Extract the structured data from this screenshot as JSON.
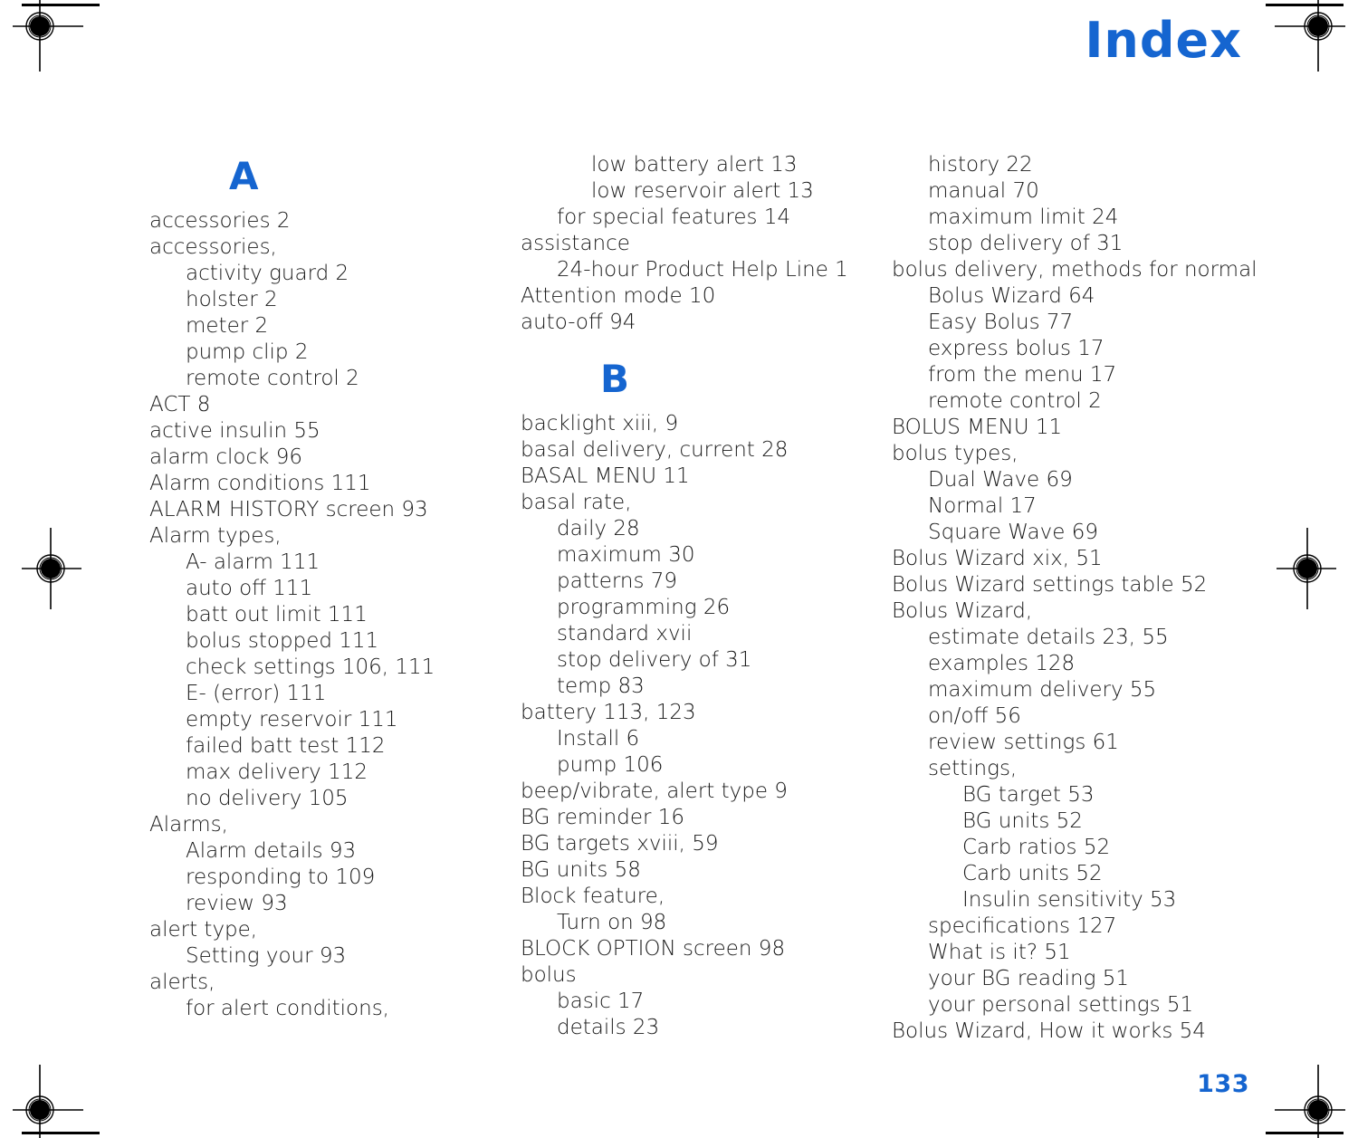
{
  "page": {
    "title": "Index",
    "folio": "133",
    "title_color": "#1565d0",
    "text_color": "#1a1a1a",
    "background_color": "#ffffff"
  },
  "marks": {
    "registration_icon": "registration-target-icon"
  },
  "columns": [
    {
      "id": "column-1",
      "blocks": [
        {
          "type": "letter",
          "label": "A",
          "spaced_above": false
        },
        {
          "type": "entries",
          "items": [
            {
              "level": 0,
              "text": "accessories 2"
            },
            {
              "level": 0,
              "text": "accessories,"
            },
            {
              "level": 1,
              "text": "activity guard 2"
            },
            {
              "level": 1,
              "text": "holster 2"
            },
            {
              "level": 1,
              "text": "meter 2"
            },
            {
              "level": 1,
              "text": "pump clip 2"
            },
            {
              "level": 1,
              "text": "remote control 2"
            },
            {
              "level": 0,
              "text": "ACT 8"
            },
            {
              "level": 0,
              "text": "active insulin 55"
            },
            {
              "level": 0,
              "text": "alarm clock 96"
            },
            {
              "level": 0,
              "text": "Alarm conditions 111"
            },
            {
              "level": 0,
              "text": "ALARM HISTORY screen 93"
            },
            {
              "level": 0,
              "text": "Alarm types,"
            },
            {
              "level": 1,
              "text": "A- alarm 111"
            },
            {
              "level": 1,
              "text": "auto off 111"
            },
            {
              "level": 1,
              "text": "batt out limit 111"
            },
            {
              "level": 1,
              "text": "bolus stopped 111"
            },
            {
              "level": 1,
              "text": "check settings 106, 111"
            },
            {
              "level": 1,
              "text": "E- (error) 111"
            },
            {
              "level": 1,
              "text": "empty reservoir 111"
            },
            {
              "level": 1,
              "text": "failed batt test 112"
            },
            {
              "level": 1,
              "text": "max delivery 112"
            },
            {
              "level": 1,
              "text": "no delivery 105"
            },
            {
              "level": 0,
              "text": "Alarms,"
            },
            {
              "level": 1,
              "text": "Alarm details 93"
            },
            {
              "level": 1,
              "text": "responding to 109"
            },
            {
              "level": 1,
              "text": "review 93"
            },
            {
              "level": 0,
              "text": "alert type,"
            },
            {
              "level": 1,
              "text": "Setting your 93"
            },
            {
              "level": 0,
              "text": "alerts,"
            },
            {
              "level": 1,
              "text": "for alert conditions,"
            }
          ]
        }
      ]
    },
    {
      "id": "column-2",
      "blocks": [
        {
          "type": "entries",
          "items": [
            {
              "level": 2,
              "text": "low battery alert 13"
            },
            {
              "level": 2,
              "text": "low reservoir alert 13"
            },
            {
              "level": 1,
              "text": "for special features 14"
            },
            {
              "level": 0,
              "text": "assistance"
            },
            {
              "level": 1,
              "text": "24-hour Product Help Line 1"
            },
            {
              "level": 0,
              "text": "Attention mode 10"
            },
            {
              "level": 0,
              "text": "auto-off 94"
            }
          ]
        },
        {
          "type": "letter",
          "label": "B",
          "spaced_above": true
        },
        {
          "type": "entries",
          "items": [
            {
              "level": 0,
              "text": "backlight xiii, 9"
            },
            {
              "level": 0,
              "text": "basal delivery, current 28"
            },
            {
              "level": 0,
              "text": "BASAL MENU 11"
            },
            {
              "level": 0,
              "text": "basal rate,"
            },
            {
              "level": 1,
              "text": "daily 28"
            },
            {
              "level": 1,
              "text": "maximum 30"
            },
            {
              "level": 1,
              "text": "patterns 79"
            },
            {
              "level": 1,
              "text": "programming 26"
            },
            {
              "level": 1,
              "text": "standard xvii"
            },
            {
              "level": 1,
              "text": "stop delivery of 31"
            },
            {
              "level": 1,
              "text": "temp 83"
            },
            {
              "level": 0,
              "text": "battery 113, 123"
            },
            {
              "level": 1,
              "text": "Install 6"
            },
            {
              "level": 1,
              "text": "pump 106"
            },
            {
              "level": 0,
              "text": "beep/vibrate, alert type 9"
            },
            {
              "level": 0,
              "text": "BG reminder 16"
            },
            {
              "level": 0,
              "text": "BG targets xviii, 59"
            },
            {
              "level": 0,
              "text": "BG units 58"
            },
            {
              "level": 0,
              "text": "Block feature,"
            },
            {
              "level": 1,
              "text": "Turn on 98"
            },
            {
              "level": 0,
              "text": "BLOCK OPTION screen 98"
            },
            {
              "level": 0,
              "text": "bolus"
            },
            {
              "level": 1,
              "text": "basic 17"
            },
            {
              "level": 1,
              "text": "details 23"
            }
          ]
        }
      ]
    },
    {
      "id": "column-3",
      "blocks": [
        {
          "type": "entries",
          "items": [
            {
              "level": 1,
              "text": "history 22"
            },
            {
              "level": 1,
              "text": "manual 70"
            },
            {
              "level": 1,
              "text": "maximum limit 24"
            },
            {
              "level": 1,
              "text": "stop delivery of 31"
            },
            {
              "level": 0,
              "text": "bolus delivery, methods for normal"
            },
            {
              "level": 1,
              "text": "Bolus Wizard 64"
            },
            {
              "level": 1,
              "text": "Easy Bolus 77"
            },
            {
              "level": 1,
              "text": "express bolus 17"
            },
            {
              "level": 1,
              "text": "from the menu 17"
            },
            {
              "level": 1,
              "text": "remote control 2"
            },
            {
              "level": 0,
              "text": "BOLUS MENU 11"
            },
            {
              "level": 0,
              "text": "bolus types,"
            },
            {
              "level": 1,
              "text": "Dual Wave 69"
            },
            {
              "level": 1,
              "text": "Normal 17"
            },
            {
              "level": 1,
              "text": "Square Wave 69"
            },
            {
              "level": 0,
              "text": "Bolus Wizard xix, 51"
            },
            {
              "level": 0,
              "text": "Bolus Wizard settings table 52"
            },
            {
              "level": 0,
              "text": "Bolus Wizard,"
            },
            {
              "level": 1,
              "text": "estimate details 23, 55"
            },
            {
              "level": 1,
              "text": "examples 128"
            },
            {
              "level": 1,
              "text": "maximum delivery 55"
            },
            {
              "level": 1,
              "text": "on/off 56"
            },
            {
              "level": 1,
              "text": "review settings 61"
            },
            {
              "level": 1,
              "text": "settings,"
            },
            {
              "level": 2,
              "text": "BG target 53"
            },
            {
              "level": 2,
              "text": "BG units 52"
            },
            {
              "level": 2,
              "text": "Carb ratios 52"
            },
            {
              "level": 2,
              "text": "Carb units 52"
            },
            {
              "level": 2,
              "text": "Insulin sensitivity 53"
            },
            {
              "level": 1,
              "text": "specifications 127"
            },
            {
              "level": 1,
              "text": "What is it? 51"
            },
            {
              "level": 1,
              "text": "your BG reading 51"
            },
            {
              "level": 1,
              "text": "your personal settings 51"
            },
            {
              "level": 0,
              "text": "Bolus Wizard, How it works 54"
            }
          ]
        }
      ]
    }
  ]
}
